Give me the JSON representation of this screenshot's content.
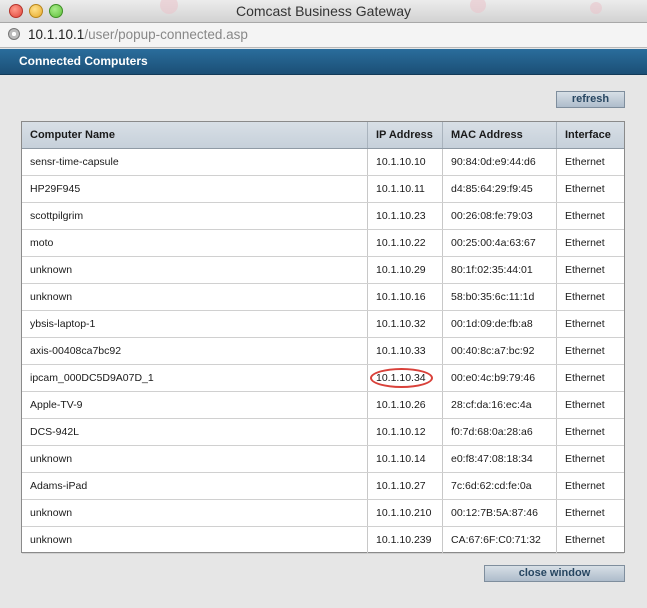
{
  "window": {
    "title": "Comcast Business Gateway",
    "url_host": "10.1.10.1",
    "url_path": "/user/popup-connected.asp"
  },
  "panel": {
    "title": "Connected Computers",
    "refresh_label": "refresh",
    "close_label": "close window"
  },
  "table": {
    "headers": [
      "Computer Name",
      "IP Address",
      "MAC Address",
      "Interface"
    ],
    "rows": [
      [
        "sensr-time-capsule",
        "10.1.10.10",
        "90:84:0d:e9:44:d6",
        "Ethernet"
      ],
      [
        "HP29F945",
        "10.1.10.11",
        "d4:85:64:29:f9:45",
        "Ethernet"
      ],
      [
        "scottpilgrim",
        "10.1.10.23",
        "00:26:08:fe:79:03",
        "Ethernet"
      ],
      [
        "moto",
        "10.1.10.22",
        "00:25:00:4a:63:67",
        "Ethernet"
      ],
      [
        "unknown",
        "10.1.10.29",
        "80:1f:02:35:44:01",
        "Ethernet"
      ],
      [
        "unknown",
        "10.1.10.16",
        "58:b0:35:6c:11:1d",
        "Ethernet"
      ],
      [
        "ybsis-laptop-1",
        "10.1.10.32",
        "00:1d:09:de:fb:a8",
        "Ethernet"
      ],
      [
        "axis-00408ca7bc92",
        "10.1.10.33",
        "00:40:8c:a7:bc:92",
        "Ethernet"
      ],
      [
        "ipcam_000DC5D9A07D_1",
        "10.1.10.34",
        "00:e0:4c:b9:79:46",
        "Ethernet"
      ],
      [
        "Apple-TV-9",
        "10.1.10.26",
        "28:cf:da:16:ec:4a",
        "Ethernet"
      ],
      [
        "DCS-942L",
        "10.1.10.12",
        "f0:7d:68:0a:28:a6",
        "Ethernet"
      ],
      [
        "unknown",
        "10.1.10.14",
        "e0:f8:47:08:18:34",
        "Ethernet"
      ],
      [
        "Adams-iPad",
        "10.1.10.27",
        "7c:6d:62:cd:fe:0a",
        "Ethernet"
      ],
      [
        "unknown",
        "10.1.10.210",
        "00:12:7B:5A:87:46",
        "Ethernet"
      ],
      [
        "unknown",
        "10.1.10.239",
        "CA:67:6F:C0:71:32",
        "Ethernet"
      ]
    ],
    "highlighted_row": 8
  },
  "colors": {
    "header_bar": "#1f5a85",
    "highlight_ring": "#d9413a"
  }
}
